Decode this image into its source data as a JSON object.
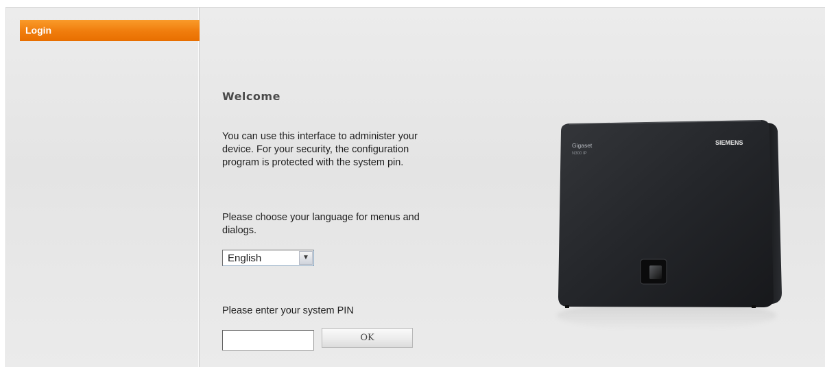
{
  "sidebar": {
    "items": [
      {
        "label": "Login",
        "active": true
      }
    ]
  },
  "main": {
    "welcome_title": "Welcome",
    "intro_text": "You can use this interface to administer your device. For your security, the configuration program is protected with the system pin.",
    "language_prompt": "Please choose your language for menus and dialogs.",
    "language_select": {
      "selected": "English"
    },
    "pin_prompt": "Please enter your system PIN",
    "pin_input": {
      "value": ""
    },
    "ok_button": "OK"
  },
  "device": {
    "brand": "SIEMENS",
    "model_name": "Gigaset",
    "model_sub": "N300 IP"
  },
  "colors": {
    "accent": "#f07c0c",
    "background": "#e8e8e8",
    "device": "#1e1f22"
  },
  "icons": [
    "chevron-down-icon"
  ]
}
